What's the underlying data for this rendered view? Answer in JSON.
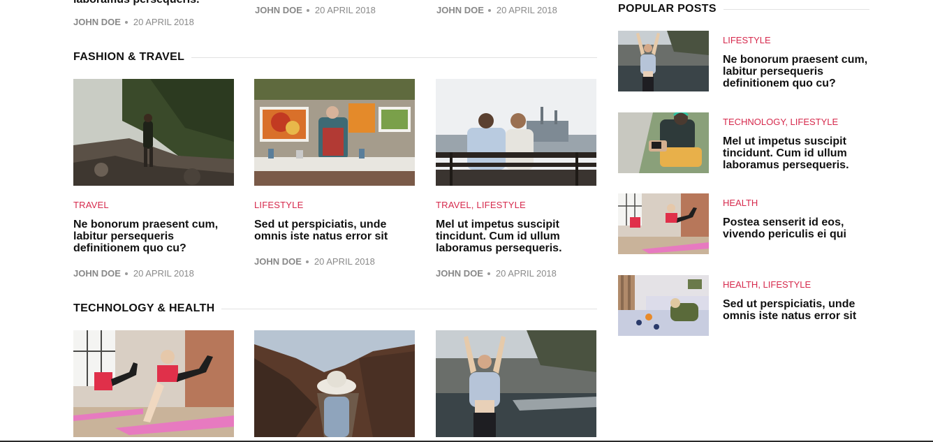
{
  "top_row": {
    "clipped_title": "laboramus persequeris.",
    "items": [
      {
        "author": "JOHN DOE",
        "date": "20 APRIL 2018"
      },
      {
        "author": "JOHN DOE",
        "date": "20 APRIL 2018"
      },
      {
        "author": "JOHN DOE",
        "date": "20 APRIL 2018"
      }
    ]
  },
  "fashion_travel": {
    "heading": "FASHION & TRAVEL",
    "cards": [
      {
        "category": "TRAVEL",
        "title": "Ne bonorum praesent cum, labitur persequeris definitionem quo cu?",
        "author": "JOHN DOE",
        "date": "20 APRIL 2018"
      },
      {
        "category": "LIFESTYLE",
        "title": "Sed ut perspiciatis, unde omnis iste natus error sit",
        "author": "JOHN DOE",
        "date": "20 APRIL 2018"
      },
      {
        "category": "TRAVEL, LIFESTYLE",
        "title": "Mel ut impetus suscipit tincidunt. Cum id ullum laboramus persequeris.",
        "author": "JOHN DOE",
        "date": "20 APRIL 2018"
      }
    ]
  },
  "technology_health": {
    "heading": "TECHNOLOGY & HEALTH"
  },
  "popular_posts": {
    "heading": "POPULAR POSTS",
    "items": [
      {
        "category": "LIFESTYLE",
        "title": "Ne bonorum praesent cum, labitur persequeris definitionem quo cu?"
      },
      {
        "category": "TECHNOLOGY, LIFESTYLE",
        "title": "Mel ut impetus suscipit tincidunt. Cum id ullum laboramus persequeris."
      },
      {
        "category": "HEALTH",
        "title": "Postea senserit id eos, vivendo periculis ei qui"
      },
      {
        "category": "HEALTH, LIFESTYLE",
        "title": "Sed ut perspiciatis, unde omnis iste natus error sit"
      }
    ]
  },
  "colors": {
    "accent": "#d6294c",
    "meta": "#8a8a8a",
    "heading": "#111111"
  }
}
